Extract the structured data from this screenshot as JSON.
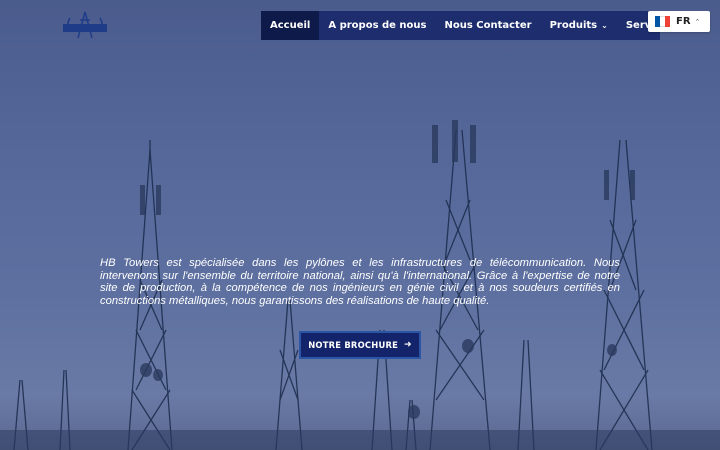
{
  "nav": {
    "items": [
      {
        "label": "Accueil",
        "active": true
      },
      {
        "label": "A propos de nous"
      },
      {
        "label": "Nous Contacter"
      },
      {
        "label": "Produits",
        "dropdown": true
      },
      {
        "label": "Services"
      }
    ]
  },
  "language": {
    "code": "FR",
    "flag_colors": [
      "#0055a4",
      "#ffffff",
      "#ef4135"
    ]
  },
  "hero": {
    "intro": "HB Towers est spécialisée dans les pylônes et les infrastructures de télécommunication. Nous intervenons sur l'ensemble du territoire national, ainsi qu'à l'international. Grâce à l'expertise de notre site de production, à la compétence de nos ingénieurs en génie civil et à nos soudeurs certifiés en constructions métalliques, nous garantissons des réalisations de haute qualité.",
    "button_label": "NOTRE BROCHURE",
    "button_icon": "arrow-right-icon"
  },
  "colors": {
    "nav_bg": "#1d2d6e",
    "nav_active": "#0e1a4a",
    "button_border": "#2a56a5"
  }
}
